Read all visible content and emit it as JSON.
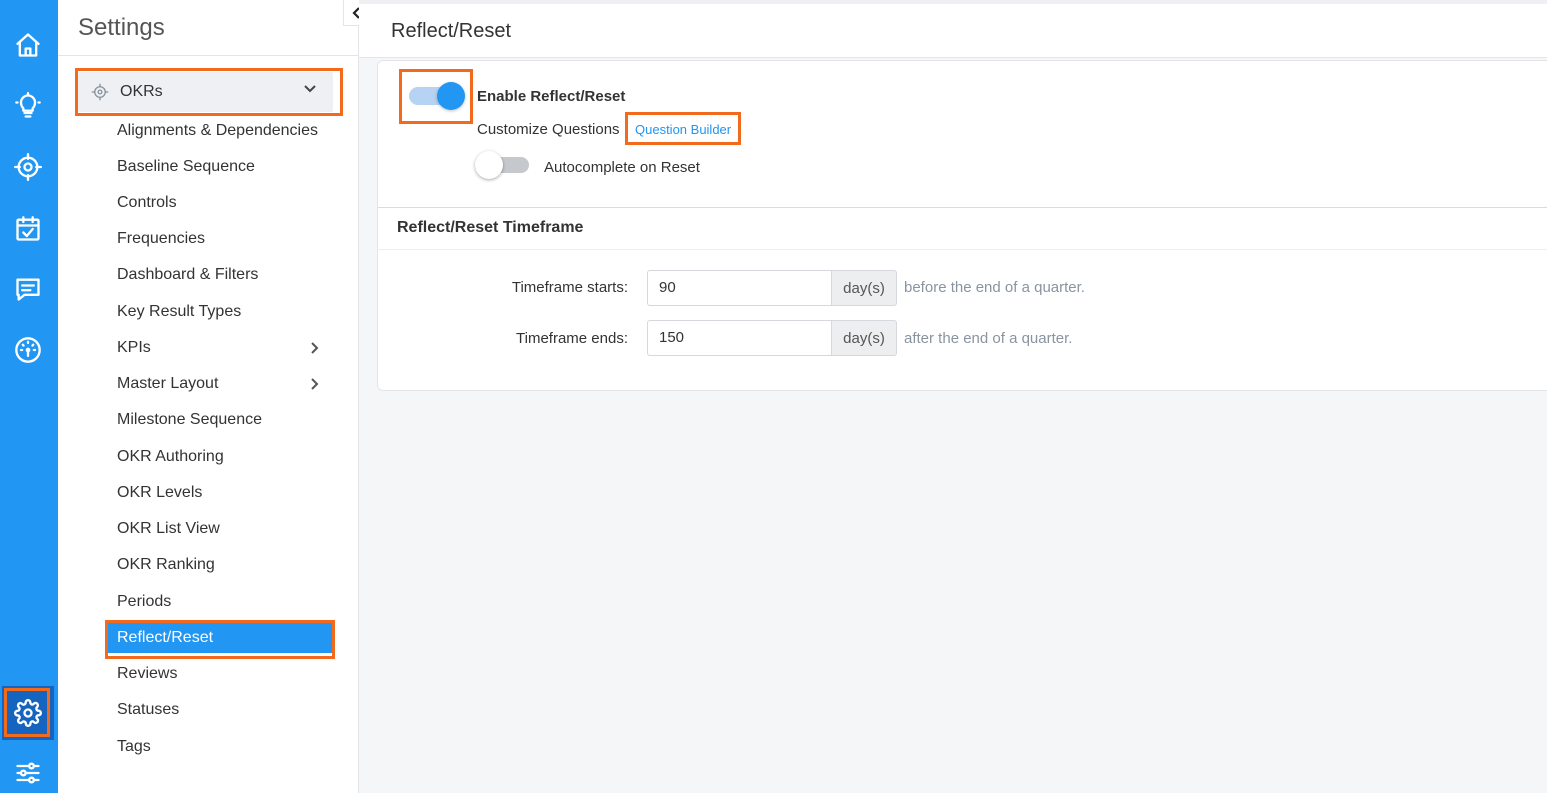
{
  "rail": {
    "icons": [
      "home-icon",
      "lightbulb-icon",
      "target-icon",
      "calendar-check-icon",
      "chat-icon",
      "gauge-icon",
      "gear-icon",
      "sliders-icon"
    ],
    "active": "gear-icon"
  },
  "settings": {
    "title": "Settings",
    "group": {
      "label": "OKRs",
      "icon": "target-icon",
      "expanded": true
    },
    "items": [
      {
        "label": "Alignments & Dependencies",
        "has_children": false
      },
      {
        "label": "Baseline Sequence",
        "has_children": false
      },
      {
        "label": "Controls",
        "has_children": false
      },
      {
        "label": "Frequencies",
        "has_children": false
      },
      {
        "label": "Dashboard & Filters",
        "has_children": false
      },
      {
        "label": "Key Result Types",
        "has_children": false
      },
      {
        "label": "KPIs",
        "has_children": true
      },
      {
        "label": "Master Layout",
        "has_children": true
      },
      {
        "label": "Milestone Sequence",
        "has_children": false
      },
      {
        "label": "OKR Authoring",
        "has_children": false
      },
      {
        "label": "OKR Levels",
        "has_children": false
      },
      {
        "label": "OKR List View",
        "has_children": false
      },
      {
        "label": "OKR Ranking",
        "has_children": false
      },
      {
        "label": "Periods",
        "has_children": false
      },
      {
        "label": "Reflect/Reset",
        "has_children": false,
        "active": true
      },
      {
        "label": "Reviews",
        "has_children": false
      },
      {
        "label": "Statuses",
        "has_children": false
      },
      {
        "label": "Tags",
        "has_children": false
      }
    ]
  },
  "main": {
    "title": "Reflect/Reset",
    "enable": {
      "label": "Enable Reflect/Reset",
      "on": true
    },
    "customize": {
      "label": "Customize Questions",
      "link": "Question Builder"
    },
    "autocomplete": {
      "label": "Autocomplete on Reset",
      "on": false
    },
    "timeframe": {
      "title": "Reflect/Reset Timeframe",
      "starts": {
        "label": "Timeframe starts:",
        "value": "90",
        "unit": "day(s)",
        "hint": "before the end of a quarter."
      },
      "ends": {
        "label": "Timeframe ends:",
        "value": "150",
        "unit": "day(s)",
        "hint": "after the end of a quarter."
      }
    }
  },
  "colors": {
    "accent": "#2196f3",
    "highlight": "#f26b1d",
    "rail_active": "#1565c0"
  }
}
